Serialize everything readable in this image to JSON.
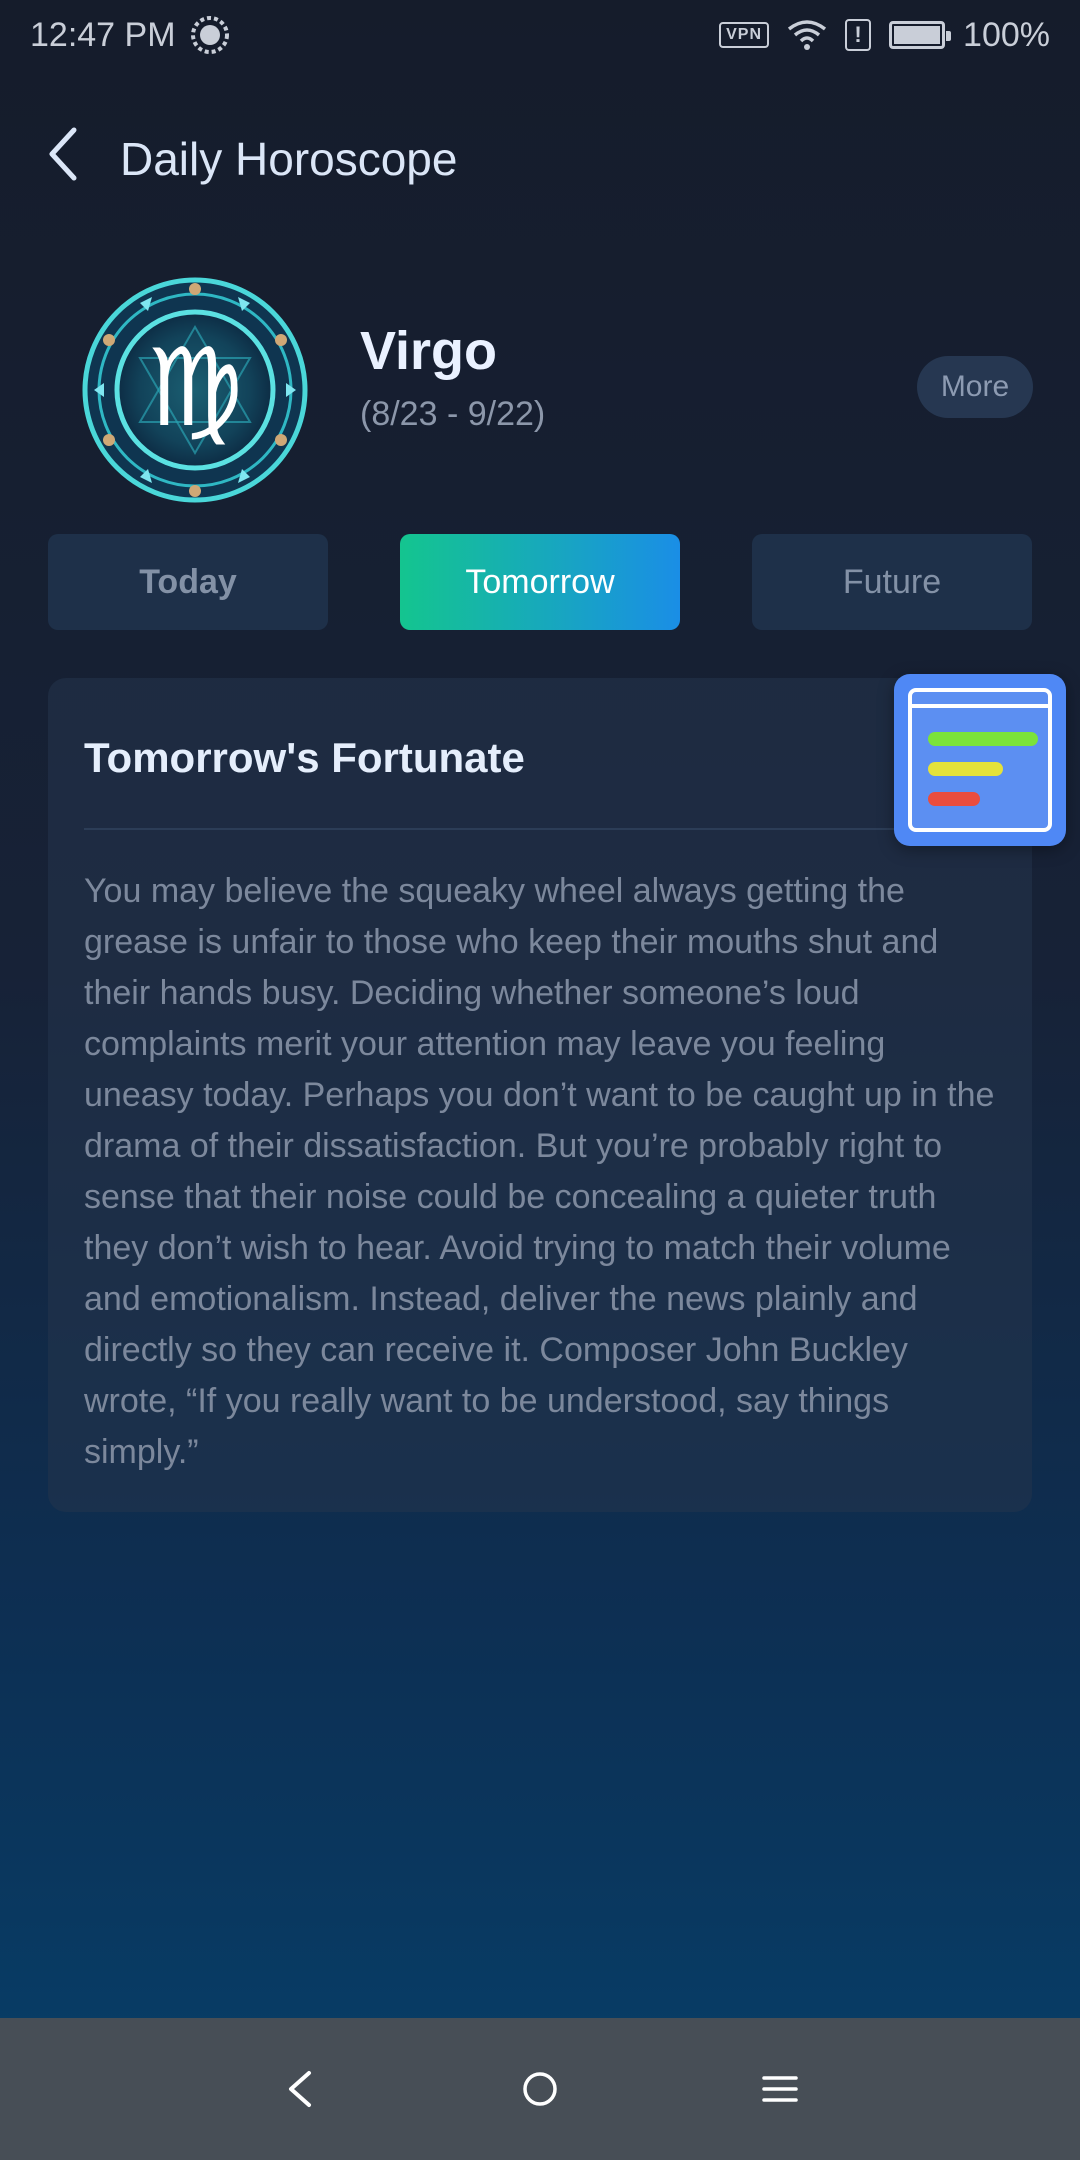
{
  "status_bar": {
    "time": "12:47 PM",
    "vpn_label": "VPN",
    "alert_symbol": "!",
    "battery_percent": "100%",
    "battery_level": 1.0
  },
  "header": {
    "title": "Daily Horoscope",
    "back_icon": "chevron-left-icon"
  },
  "sign": {
    "name": "Virgo",
    "dates": "(8/23 - 9/22)",
    "symbol": "♍",
    "more_label": "More"
  },
  "tabs": [
    {
      "label": "Today",
      "active": false
    },
    {
      "label": "Tomorrow",
      "active": true
    },
    {
      "label": "Future",
      "active": false
    }
  ],
  "card": {
    "title": "Tomorrow's Fortunate",
    "body": "You may believe the squeaky wheel always getting the grease is unfair to those who keep their mouths shut and their hands busy. Deciding whether someone’s loud complaints merit your attention may leave you feeling uneasy today. Perhaps you don’t want to be caught up in the drama of their dissatisfaction. But you’re probably right to sense that their noise could be concealing a quieter truth they don’t wish to hear. Avoid trying to match their volume and emotionalism. Instead, deliver the news plainly and directly so they can receive it. Composer John Buckley wrote, “If you really want to be understood, say things simply.”"
  },
  "colors": {
    "accent_green": "#14c58f",
    "accent_blue": "#1a8ee6",
    "widget_blue": "#4f88f5"
  },
  "nav": {
    "back_icon": "triangle-back-icon",
    "home_icon": "circle-home-icon",
    "menu_icon": "menu-lines-icon"
  }
}
